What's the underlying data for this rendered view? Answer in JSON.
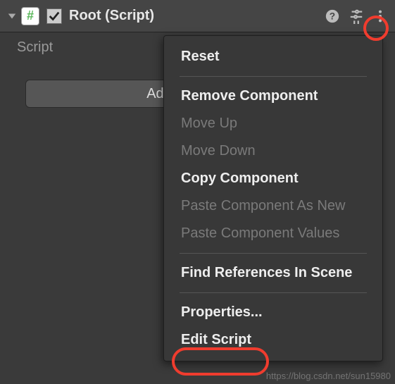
{
  "component": {
    "title": "Root (Script)",
    "enabled": true,
    "scriptIconGlyph": "#"
  },
  "field": {
    "label": "Script"
  },
  "addButton": {
    "label": "Add Component"
  },
  "menu": {
    "items": [
      {
        "label": "Reset",
        "enabled": true,
        "key": "reset"
      },
      {
        "sep": true
      },
      {
        "label": "Remove Component",
        "enabled": true,
        "key": "remove-component"
      },
      {
        "label": "Move Up",
        "enabled": false,
        "key": "move-up"
      },
      {
        "label": "Move Down",
        "enabled": false,
        "key": "move-down"
      },
      {
        "label": "Copy Component",
        "enabled": true,
        "key": "copy-component"
      },
      {
        "label": "Paste Component As New",
        "enabled": false,
        "key": "paste-component-as-new"
      },
      {
        "label": "Paste Component Values",
        "enabled": false,
        "key": "paste-component-values"
      },
      {
        "sep": true
      },
      {
        "label": "Find References In Scene",
        "enabled": true,
        "key": "find-references"
      },
      {
        "sep": true
      },
      {
        "label": "Properties...",
        "enabled": true,
        "key": "properties"
      },
      {
        "label": "Edit Script",
        "enabled": true,
        "key": "edit-script"
      }
    ]
  },
  "watermark": "https://blog.csdn.net/sun15980"
}
